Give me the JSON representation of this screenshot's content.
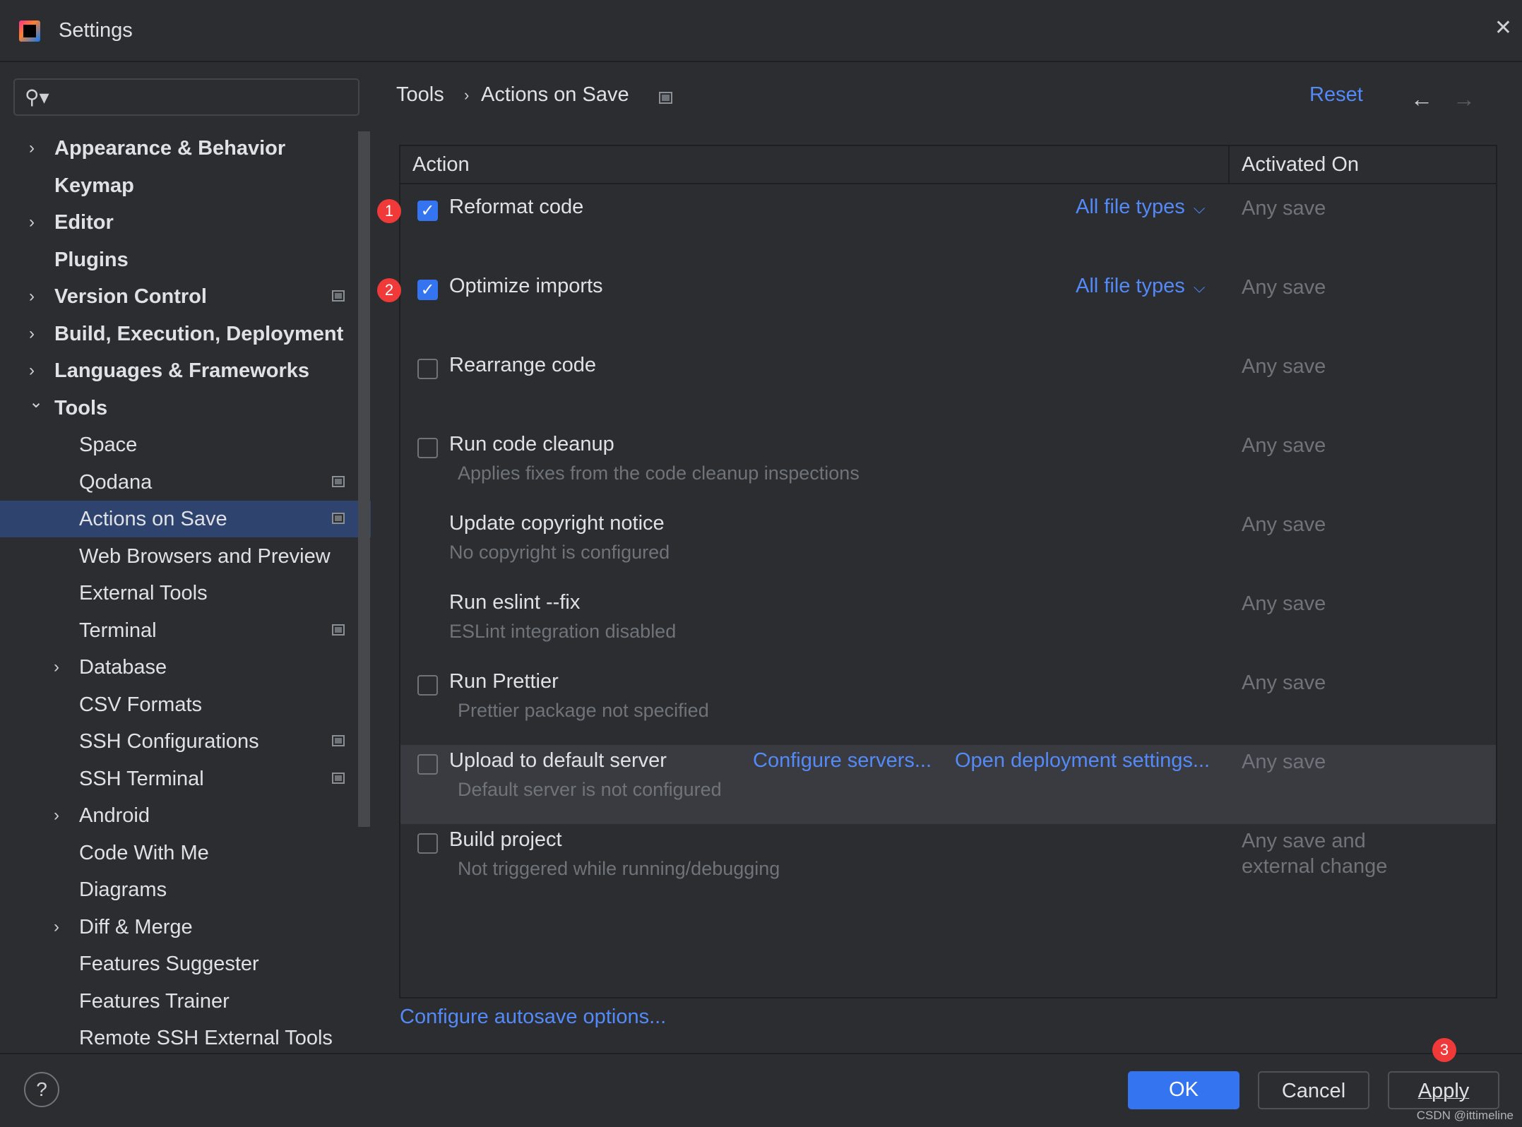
{
  "window": {
    "title": "Settings",
    "close_icon": "close-icon"
  },
  "sidebar": {
    "search_placeholder": "",
    "items": [
      {
        "label": "Appearance & Behavior",
        "level": 0,
        "expandable": true,
        "expanded": false,
        "pinned": false
      },
      {
        "label": "Keymap",
        "level": 0,
        "expandable": false,
        "pinned": false
      },
      {
        "label": "Editor",
        "level": 0,
        "expandable": true,
        "expanded": false,
        "pinned": false
      },
      {
        "label": "Plugins",
        "level": 0,
        "expandable": false,
        "pinned": false
      },
      {
        "label": "Version Control",
        "level": 0,
        "expandable": true,
        "expanded": false,
        "pinned": true
      },
      {
        "label": "Build, Execution, Deployment",
        "level": 0,
        "expandable": true,
        "expanded": false,
        "pinned": false
      },
      {
        "label": "Languages & Frameworks",
        "level": 0,
        "expandable": true,
        "expanded": false,
        "pinned": false
      },
      {
        "label": "Tools",
        "level": 0,
        "expandable": true,
        "expanded": true,
        "pinned": false
      },
      {
        "label": "Space",
        "level": 1,
        "expandable": false,
        "pinned": false
      },
      {
        "label": "Qodana",
        "level": 1,
        "expandable": false,
        "pinned": true
      },
      {
        "label": "Actions on Save",
        "level": 1,
        "expandable": false,
        "pinned": true,
        "selected": true
      },
      {
        "label": "Web Browsers and Preview",
        "level": 1,
        "expandable": false,
        "pinned": false
      },
      {
        "label": "External Tools",
        "level": 1,
        "expandable": false,
        "pinned": false
      },
      {
        "label": "Terminal",
        "level": 1,
        "expandable": false,
        "pinned": true
      },
      {
        "label": "Database",
        "level": 1,
        "expandable": true,
        "expanded": false,
        "pinned": false
      },
      {
        "label": "CSV Formats",
        "level": 1,
        "expandable": false,
        "pinned": false
      },
      {
        "label": "SSH Configurations",
        "level": 1,
        "expandable": false,
        "pinned": true
      },
      {
        "label": "SSH Terminal",
        "level": 1,
        "expandable": false,
        "pinned": true
      },
      {
        "label": "Android",
        "level": 1,
        "expandable": true,
        "expanded": false,
        "pinned": false
      },
      {
        "label": "Code With Me",
        "level": 1,
        "expandable": false,
        "pinned": false
      },
      {
        "label": "Diagrams",
        "level": 1,
        "expandable": false,
        "pinned": false
      },
      {
        "label": "Diff & Merge",
        "level": 1,
        "expandable": true,
        "expanded": false,
        "pinned": false
      },
      {
        "label": "Features Suggester",
        "level": 1,
        "expandable": false,
        "pinned": false
      },
      {
        "label": "Features Trainer",
        "level": 1,
        "expandable": false,
        "pinned": false
      },
      {
        "label": "Remote SSH External Tools",
        "level": 1,
        "expandable": false,
        "pinned": false
      }
    ]
  },
  "header": {
    "breadcrumb": [
      "Tools",
      "Actions on Save"
    ],
    "separator": "›",
    "reset": "Reset",
    "back": "←",
    "forward": "→"
  },
  "table": {
    "columns": [
      "Action",
      "Activated On"
    ],
    "rows": [
      {
        "label": "Reformat code",
        "checkbox": true,
        "checked": true,
        "badge": "1",
        "filter": "All file types",
        "activated": "Any save"
      },
      {
        "label": "Optimize imports",
        "checkbox": true,
        "checked": true,
        "badge": "2",
        "filter": "All file types",
        "activated": "Any save"
      },
      {
        "label": "Rearrange code",
        "checkbox": true,
        "checked": false,
        "activated": "Any save"
      },
      {
        "label": "Run code cleanup",
        "checkbox": true,
        "checked": false,
        "sub": "Applies fixes from the code cleanup inspections",
        "activated": "Any save"
      },
      {
        "label": "Update copyright notice",
        "checkbox": false,
        "sub": "No copyright is configured",
        "activated": "Any save"
      },
      {
        "label": "Run eslint --fix",
        "checkbox": false,
        "sub": "ESLint integration disabled",
        "activated": "Any save"
      },
      {
        "label": "Run Prettier",
        "checkbox": true,
        "checked": false,
        "sub": "Prettier package not specified",
        "activated": "Any save"
      },
      {
        "label": "Upload to default server",
        "checkbox": true,
        "checked": false,
        "sub": "Default server is not configured",
        "links": [
          "Configure servers...",
          "Open deployment settings..."
        ],
        "activated": "Any save",
        "highlighted": true
      },
      {
        "label": "Build project",
        "checkbox": true,
        "checked": false,
        "sub": "Not triggered while running/debugging",
        "activated": "Any save and\nexternal change"
      }
    ]
  },
  "autosave_link": "Configure autosave options...",
  "footer": {
    "help": "?",
    "ok": "OK",
    "cancel": "Cancel",
    "apply": "Apply",
    "apply_badge": "3"
  },
  "watermark": "CSDN @ittimeline",
  "colors": {
    "accent": "#3574f0",
    "link": "#548af7",
    "selection": "#2e436e",
    "badge": "#f03a3a",
    "background": "#2b2d30"
  }
}
